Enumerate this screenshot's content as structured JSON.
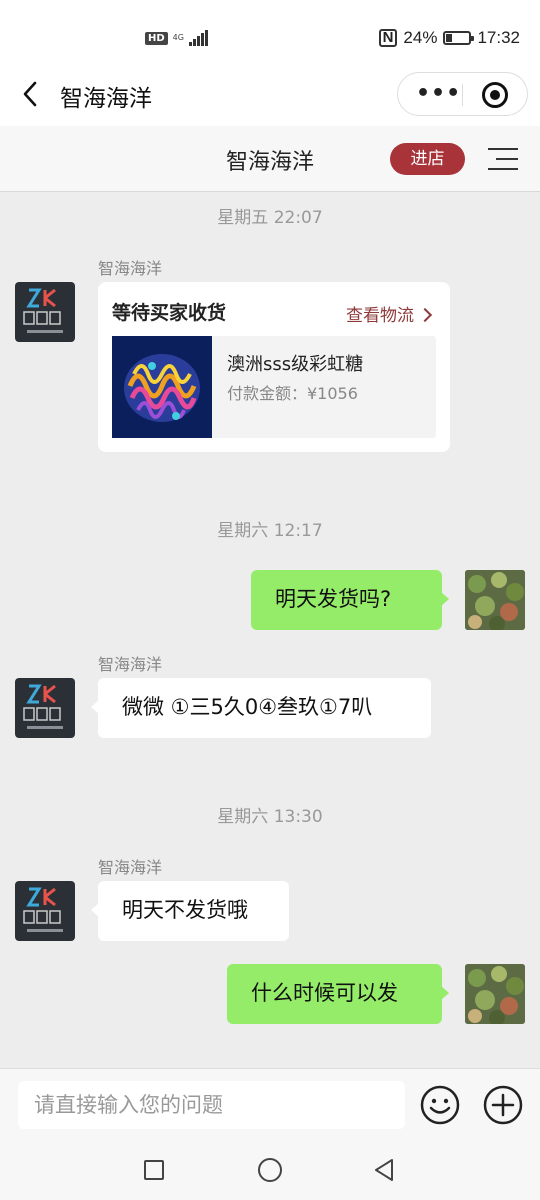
{
  "status_bar": {
    "hd": "HD",
    "network": "4G",
    "nfc": "N",
    "battery": "24%",
    "battery_level": 0.24,
    "time": "17:32"
  },
  "title_bar": {
    "title": "智海海洋",
    "icons": [
      "back-icon",
      "more-icon",
      "target-icon"
    ]
  },
  "shop_bar": {
    "name": "智海海洋",
    "enter_label": "进店",
    "menu_icon": "menu-icon"
  },
  "messages": {
    "time_1": "星期五 22:07",
    "time_2": "星期六 12:17",
    "time_3": "星期六 13:30",
    "sender": "智海海洋",
    "order": {
      "status": "等待买家收货",
      "link": "查看物流",
      "product_name": "澳洲sss级彩虹糖",
      "price": "付款金额：¥1056"
    },
    "msg_1": "明天发货吗?",
    "msg_2": "微微 ①三5久0④叁玖①7叭",
    "msg_3": "明天不发货哦",
    "msg_4": "什么时候可以发"
  },
  "input_bar": {
    "placeholder": "请直接输入您的问题",
    "icons": [
      "emoji-icon",
      "plus-icon"
    ]
  },
  "nav_bar": {
    "icons": [
      "recent-apps-icon",
      "home-icon",
      "back-nav-icon"
    ]
  },
  "colors": {
    "accent": "#a8343a",
    "bubble_right": "#95ec69",
    "bubble_left": "#ffffff",
    "background": "#ededed"
  }
}
